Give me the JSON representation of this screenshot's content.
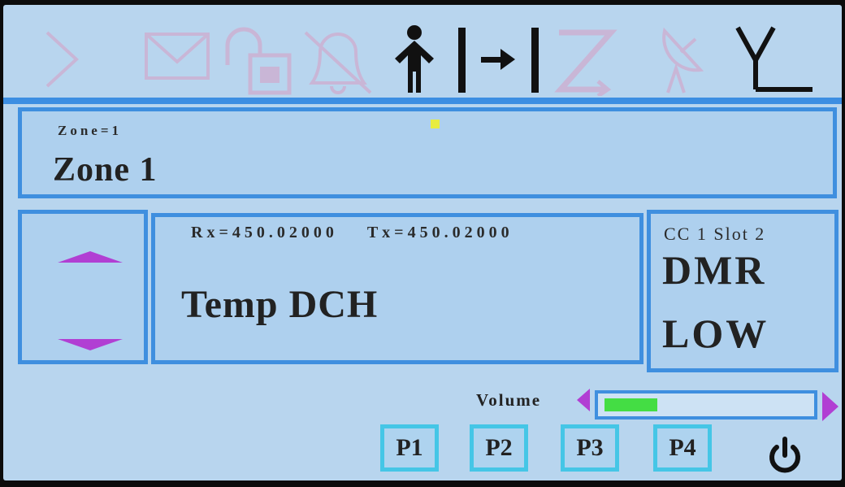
{
  "status_icons": {
    "play": "play-icon",
    "message": "envelope-icon",
    "lock": "unlock-icon",
    "alarm": "bell-icon",
    "person": "person-icon",
    "scan": "scan-icon",
    "zone": "zone-icon",
    "gps": "satellite-icon",
    "signal": "antenna-icon"
  },
  "zone": {
    "small_label": "Zone=1",
    "name": "Zone 1"
  },
  "channel": {
    "rx": "Rx=450.02000",
    "tx": "Tx=450.02000",
    "name": "Temp DCH"
  },
  "mode": {
    "cc_slot": "CC 1 Slot 2",
    "type": "DMR",
    "power": "LOW"
  },
  "volume": {
    "label": "Volume",
    "level": 0.26
  },
  "buttons": {
    "p1": "P1",
    "p2": "P2",
    "p3": "P3",
    "p4": "P4"
  },
  "colors": {
    "background": "#b8d5ee",
    "panel_border": "#3f8fdf",
    "button_border": "#45c6e6",
    "arrow": "#b13fd3",
    "volume_fill": "#44dd44",
    "inactive_icon": "#c9b6d6",
    "active_icon": "#111111"
  }
}
